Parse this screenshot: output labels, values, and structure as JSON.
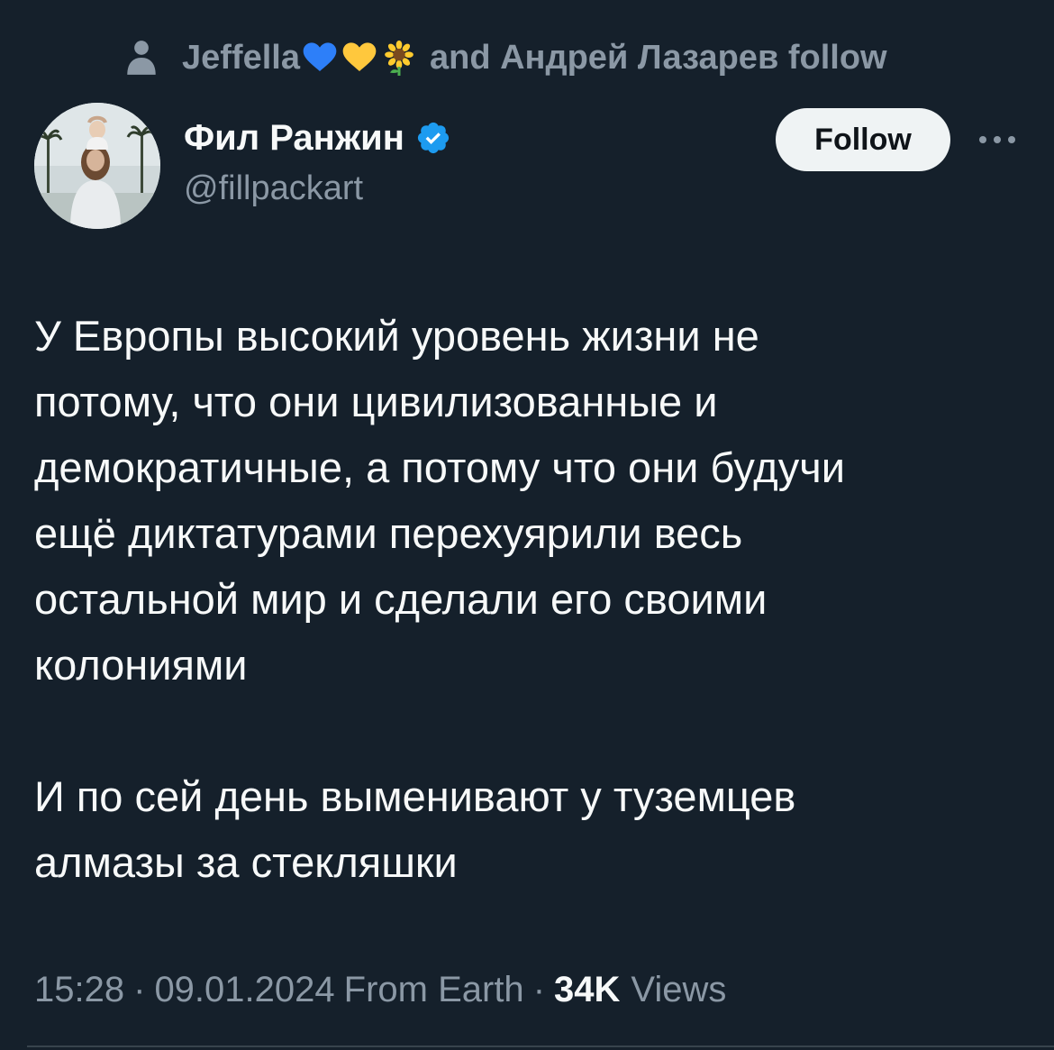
{
  "social_context": {
    "name_prefix": "Jeffella",
    "emojis": [
      "blue-heart",
      "yellow-heart",
      "sunflower"
    ],
    "suffix": "and Андрей Лазарев follow"
  },
  "author": {
    "display_name": "Фил Ранжин",
    "handle": "@fillpackart",
    "verified": true
  },
  "follow_button": {
    "label": "Follow"
  },
  "tweet": {
    "paragraphs": [
      "У Европы высокий уровень жизни не\nпотому, что они цивилизованные и\nдемократичные, а потому что они будучи\nещё диктатурами перехуярили весь\nостальной мир и сделали его своими\nколониями",
      "И по сей день выменивают у туземцев\nалмазы за стекляшки"
    ]
  },
  "meta": {
    "time": "15:28",
    "separator": "·",
    "date": "09.01.2024",
    "source": "From Earth",
    "views_count": "34K",
    "views_label": "Views"
  },
  "colors": {
    "background": "#15202b",
    "text_primary": "#f7f9f9",
    "text_secondary": "#8b98a5",
    "verified_blue": "#1d9bf0",
    "follow_button_bg": "#eff3f4"
  }
}
